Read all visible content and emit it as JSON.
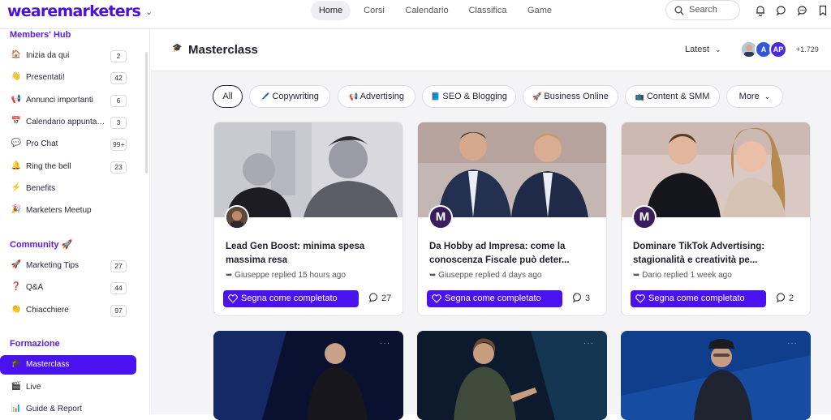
{
  "brand": {
    "logo": "wearemarketers",
    "accent": "#4b12f0"
  },
  "nav": {
    "items": [
      {
        "label": "Home",
        "active": true
      },
      {
        "label": "Corsi",
        "active": false
      },
      {
        "label": "Calendario",
        "active": false
      },
      {
        "label": "Classifica",
        "active": false
      },
      {
        "label": "Game",
        "active": false
      }
    ]
  },
  "search": {
    "placeholder": "Search"
  },
  "sidebar": {
    "sections": [
      {
        "title": "Members' Hub",
        "items": [
          {
            "emoji": "🏠",
            "label": "Inizia da qui",
            "count": "2"
          },
          {
            "emoji": "👋",
            "label": "Presentati!",
            "count": "42"
          },
          {
            "emoji": "📢",
            "label": "Annunci importanti",
            "count": "6"
          },
          {
            "emoji": "📅",
            "label": "Calendario appuntamenti",
            "count": "3"
          },
          {
            "emoji": "💬",
            "label": "Pro Chat",
            "count": "99+"
          },
          {
            "emoji": "🔔",
            "label": "Ring the bell",
            "count": "23"
          },
          {
            "emoji": "⚡",
            "label": "Benefits",
            "count": ""
          },
          {
            "emoji": "🎉",
            "label": "Marketers Meetup",
            "count": ""
          }
        ]
      },
      {
        "title": "Community 🚀",
        "items": [
          {
            "emoji": "🚀",
            "label": "Marketing Tips",
            "count": "27"
          },
          {
            "emoji": "❓",
            "label": "Q&A",
            "count": "44"
          },
          {
            "emoji": "👏",
            "label": "Chiacchiere",
            "count": "97"
          }
        ]
      },
      {
        "title": "Formazione",
        "items": [
          {
            "emoji": "🎓",
            "label": "Masterclass",
            "count": "",
            "active": true
          },
          {
            "emoji": "🎬",
            "label": "Live",
            "count": ""
          },
          {
            "emoji": "📊",
            "label": "Guide & Report",
            "count": ""
          }
        ]
      }
    ]
  },
  "main": {
    "title": "Masterclass",
    "icon": "graduation-cap-icon",
    "sort_label": "Latest",
    "members": {
      "avatars": [
        "photo",
        "A",
        "AP"
      ],
      "more": "+1.729"
    },
    "filters": [
      {
        "emoji": "",
        "label": "All",
        "active": true
      },
      {
        "emoji": "🖊️",
        "label": "Copywriting"
      },
      {
        "emoji": "📢",
        "label": "Advertising"
      },
      {
        "emoji": "📘",
        "label": "SEO & Blogging"
      },
      {
        "emoji": "🚀",
        "label": "Business Online"
      },
      {
        "emoji": "📺",
        "label": "Content & SMM"
      },
      {
        "emoji": "",
        "label": "More"
      }
    ],
    "cards": [
      {
        "title": "Lead Gen Boost: minima spesa massima resa",
        "author": "Giuseppe",
        "meta": "Giuseppe replied 15 hours ago",
        "button": "Segna come completato",
        "comments": "27",
        "avatar": "photo"
      },
      {
        "title": "Da Hobby ad Impresa: come la conoscenza Fiscale può deter...",
        "author": "Giuseppe",
        "meta": "Giuseppe replied 4 days ago",
        "button": "Segna come completato",
        "comments": "3",
        "avatar": "M"
      },
      {
        "title": "Dominare TikTok Advertising: stagionalità e creatività pe...",
        "author": "Dario",
        "meta": "Dario replied 1 week ago",
        "button": "Segna come completato",
        "comments": "2",
        "avatar": "M"
      }
    ],
    "cards_row2": [
      {
        "dots": "···"
      },
      {
        "dots": "···"
      },
      {
        "dots": "···"
      }
    ]
  }
}
